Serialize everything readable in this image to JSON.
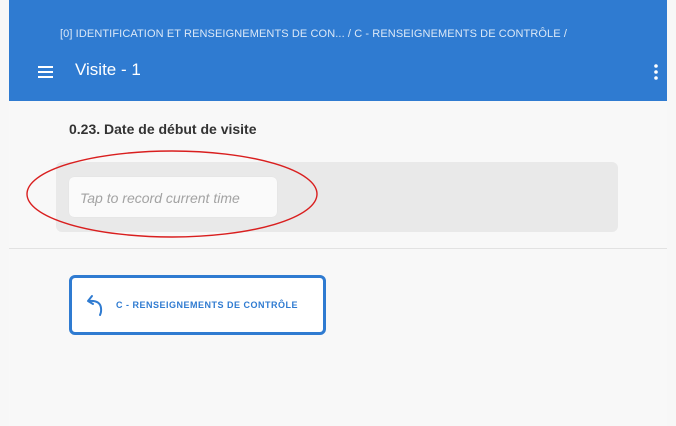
{
  "header": {
    "breadcrumb": "[0] IDENTIFICATION ET RENSEIGNEMENTS DE CON... / C - RENSEIGNEMENTS DE CONTRÔLE /",
    "title": "Visite - 1",
    "menu_icon": "hamburger-menu-icon",
    "more_icon": "more-vertical-icon"
  },
  "question": {
    "label": "0.23. Date de début de visite",
    "placeholder": "Tap to record current time"
  },
  "navigation": {
    "back_label": "C - RENSEIGNEMENTS DE CONTRÔLE",
    "back_icon": "curved-back-arrow-icon"
  },
  "colors": {
    "app_bar": "#2f7bd1",
    "accent": "#2f7bd1",
    "highlight": "#d91f1f"
  }
}
